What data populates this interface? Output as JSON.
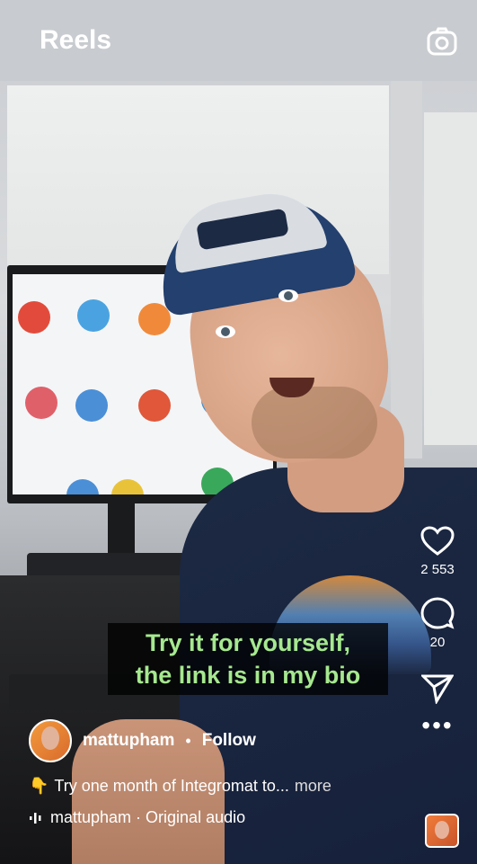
{
  "header": {
    "title": "Reels",
    "camera_icon": "camera-icon"
  },
  "caption": {
    "line1": "Try it for yourself,",
    "line2": "the link is in my bio"
  },
  "actions": {
    "like_count": "2 553",
    "comment_count": "20",
    "more_label": "•••"
  },
  "post": {
    "username": "mattupham",
    "separator": "•",
    "follow_label": "Follow",
    "emoji": "👇",
    "description": "Try one month of Integromat to...",
    "more_label": "more",
    "audio_text": "mattupham · Original audio"
  },
  "colors": {
    "caption_text": "#a6e88f",
    "caption_bg": "#000000"
  }
}
